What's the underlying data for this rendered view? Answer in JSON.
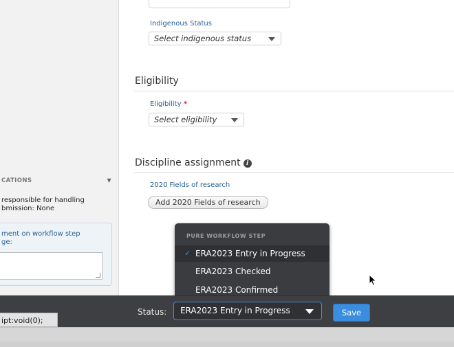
{
  "left_panel": {
    "notifications_header": "CATIONS",
    "notification_text_line1": "responsible for handling",
    "notification_text_line2": "bmission: None",
    "comment_label_line1": "ment on workflow step",
    "comment_label_line2": "ge:"
  },
  "form": {
    "indigenous": {
      "label": "Indigenous Status",
      "placeholder": "Select indigenous status"
    },
    "eligibility_section_title": "Eligibility",
    "eligibility": {
      "label": "Eligibility",
      "required_marker": "*",
      "placeholder": "Select eligibility"
    },
    "discipline_section_title": "Discipline assignment",
    "discipline_info_icon": "info-icon",
    "fields_of_research": {
      "label": "2020 Fields of research",
      "add_button_label": "Add 2020 Fields of research"
    }
  },
  "workflow_dropdown": {
    "header": "PURE WORKFLOW STEP",
    "items": [
      {
        "label": "ERA2023 Entry in Progress",
        "selected": true
      },
      {
        "label": "ERA2023 Checked",
        "selected": false
      },
      {
        "label": "ERA2023 Confirmed",
        "selected": false
      }
    ],
    "check_mark": "✓"
  },
  "status_bar": {
    "tooltip_text": "ipt:void(0);",
    "status_label": "Status:",
    "status_value": "ERA2023 Entry in Progress",
    "save_label": "Save"
  },
  "colors": {
    "accent_blue": "#3b8de0",
    "label_blue": "#2a5f96",
    "dark_bar": "#3d3f42",
    "required_red": "#dd2233"
  }
}
